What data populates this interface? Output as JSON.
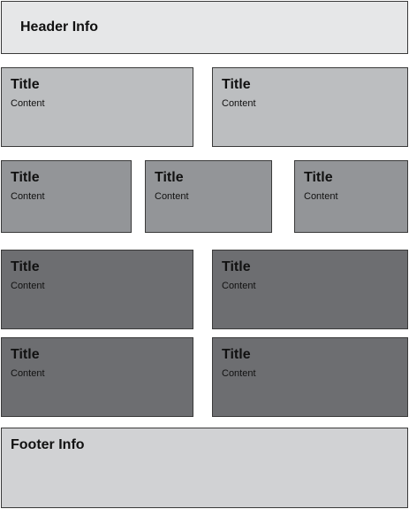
{
  "header": {
    "label": "Header Info"
  },
  "footer": {
    "label": "Footer Info"
  },
  "cards": [
    {
      "title": "Title",
      "content": "Content"
    },
    {
      "title": "Title",
      "content": "Content"
    },
    {
      "title": "Title",
      "content": "Content"
    },
    {
      "title": "Title",
      "content": "Content"
    },
    {
      "title": "Title",
      "content": "Content"
    },
    {
      "title": "Title",
      "content": "Content"
    },
    {
      "title": "Title",
      "content": "Content"
    },
    {
      "title": "Title",
      "content": "Content"
    },
    {
      "title": "Title",
      "content": "Content"
    }
  ],
  "colors": {
    "header": "#e6e7e8",
    "row1": "#bcbec0",
    "row2": "#939598",
    "row3_4": "#6d6e71",
    "footer": "#d1d2d4"
  }
}
